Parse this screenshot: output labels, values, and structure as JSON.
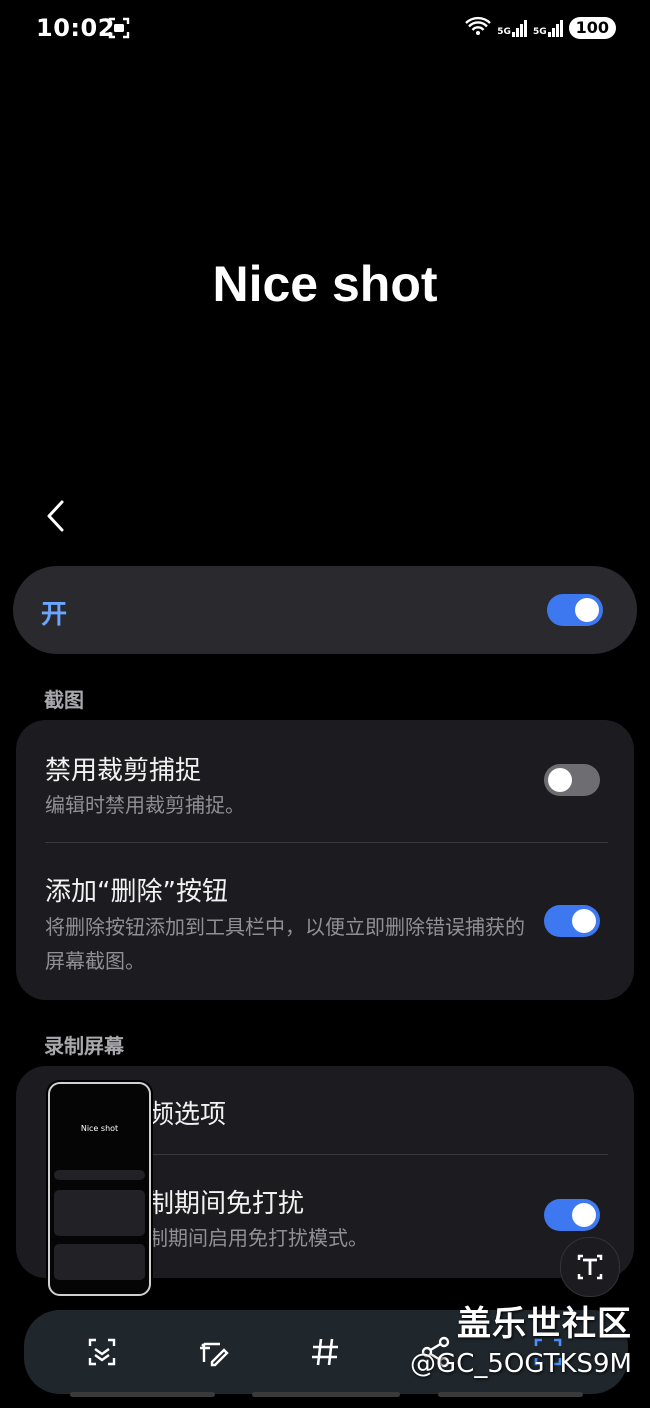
{
  "status_bar": {
    "time": "10:02",
    "sig1": "5G",
    "sig2": "5G",
    "battery": "100"
  },
  "page": {
    "title": "Nice shot",
    "back_icon": "chevron-left-icon"
  },
  "master_switch": {
    "label": "开",
    "state": "on"
  },
  "sections": {
    "screenshot": "截图",
    "screen_record": "录制屏幕"
  },
  "screenshot_settings": [
    {
      "title": "禁用裁剪捕捉",
      "subtitle": "编辑时禁用裁剪捕捉。",
      "state": "off"
    },
    {
      "title": "添加“删除”按钮",
      "subtitle": "将删除按钮添加到工具栏中，以便立即删除错误捕获的屏幕截图。",
      "state": "on"
    }
  ],
  "record_settings": [
    {
      "title": "频选项",
      "subtitle": ""
    },
    {
      "title": "制期间免打扰",
      "subtitle": "制期间启用免打扰模式。",
      "state": "on"
    }
  ],
  "thumbnail": {
    "title": "Nice shot"
  },
  "toolbar": {
    "tools": [
      "smart-select-icon",
      "edit-draw-icon",
      "hashtag-icon",
      "share-icon",
      "scan-icon"
    ]
  },
  "watermark": {
    "line1": "盖乐世社区",
    "line2": "@GC_5OGTKS9M"
  },
  "colors": {
    "accent": "#3e78f0",
    "label_accent": "#6aa5ff",
    "card": "#1c1c20",
    "background": "#000000"
  }
}
